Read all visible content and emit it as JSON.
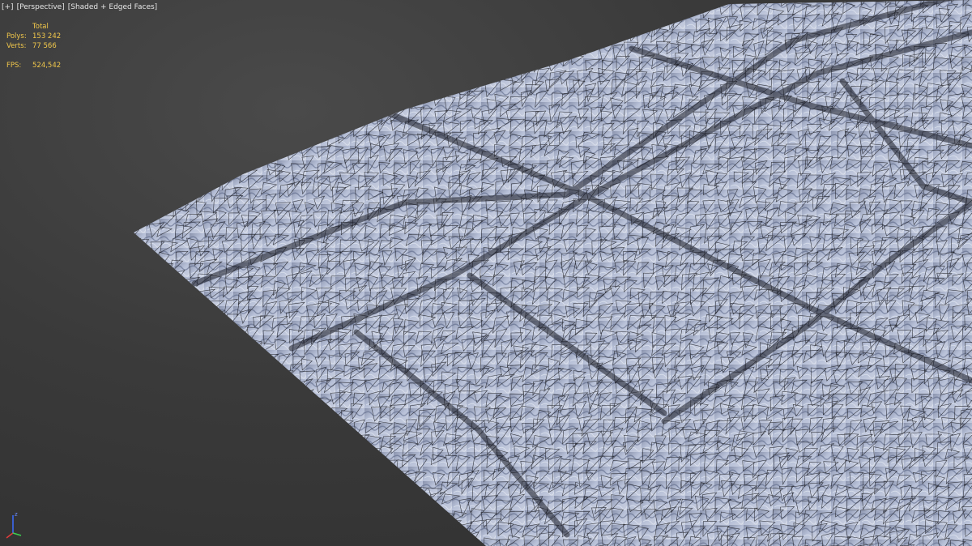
{
  "viewport": {
    "menu_label": "[+]",
    "view_label": "[Perspective]",
    "shading_label": "[Shaded + Edged Faces]"
  },
  "stats": {
    "header": "Total",
    "polys_label": "Polys:",
    "polys_value": "153 242",
    "verts_label": "Verts:",
    "verts_value": "77 566",
    "fps_label": "FPS:",
    "fps_value": "524,542"
  },
  "gizmo": {
    "z_label": "z"
  },
  "colors": {
    "stats_text": "#f2c84b",
    "label_text": "#e6e6e6",
    "mesh_surface": "#b4bdd6",
    "wireframe": "#0c0c10",
    "background": "#3a3a3a"
  }
}
